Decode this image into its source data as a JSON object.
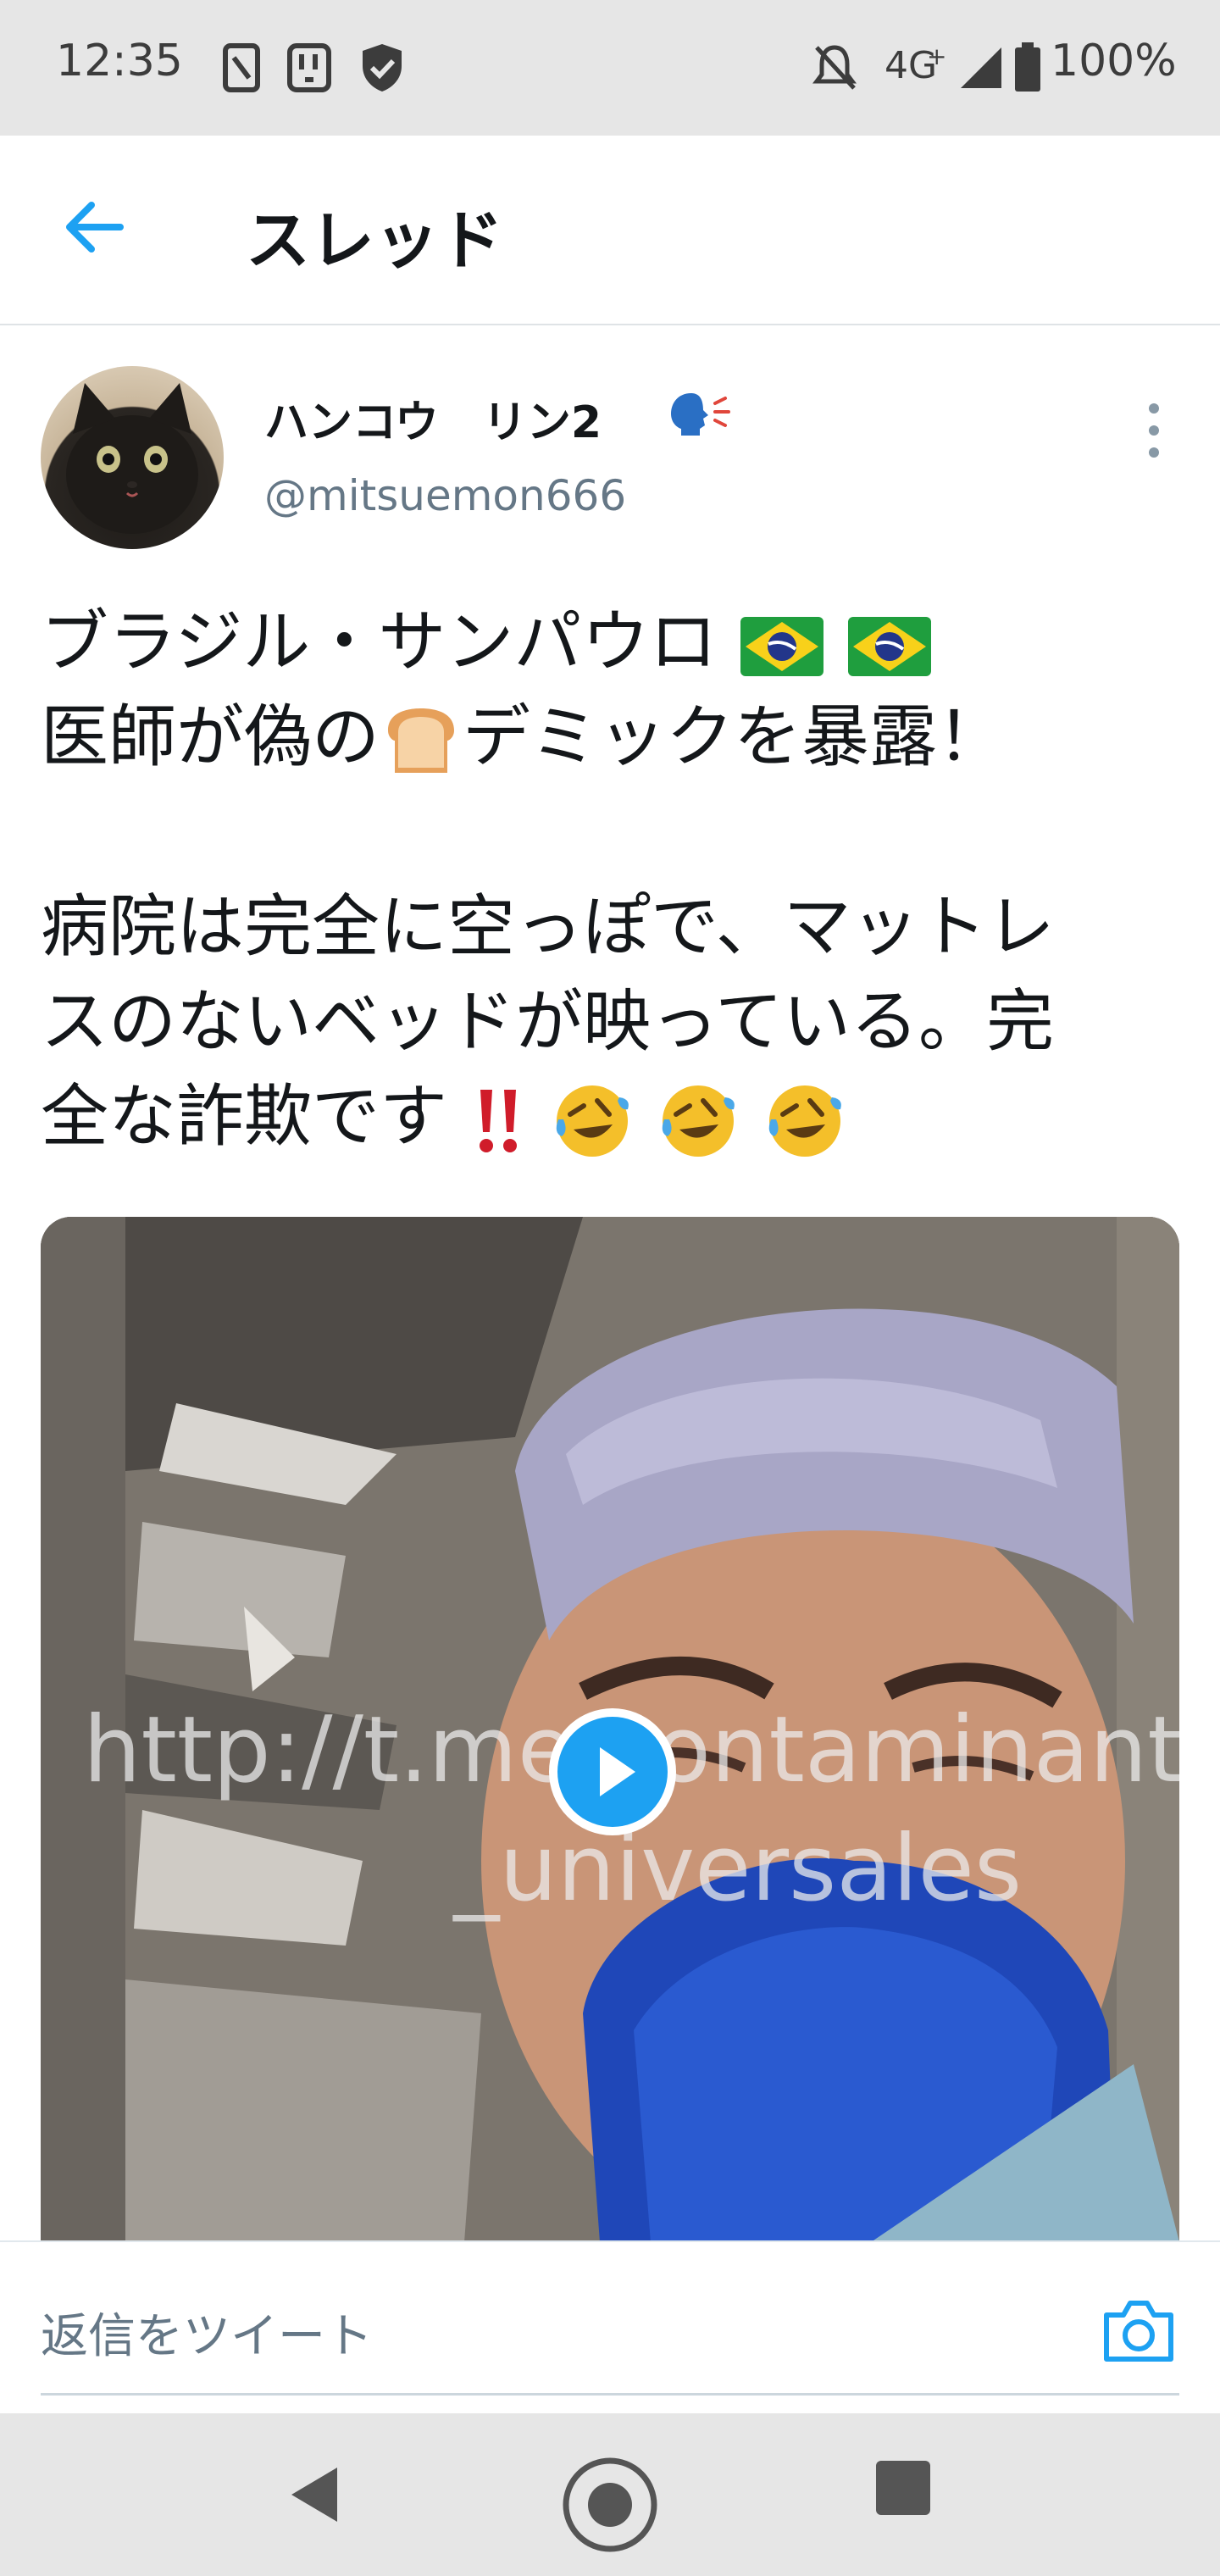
{
  "status_bar": {
    "time": "12:35",
    "network": "4G",
    "battery": "100%",
    "icons": [
      "sim-card-icon",
      "notification-app-icon",
      "shield-check-icon",
      "notifications-off-icon",
      "signal-icon",
      "battery-icon"
    ]
  },
  "header": {
    "title": "スレッド",
    "back_icon": "arrow-left-icon"
  },
  "tweet": {
    "display_name": "ハンコウ　リン2",
    "handle": "@mitsuemon666",
    "text_lines": [
      "ブラジル・サンパウロ",
      "医師が偽の",
      "デミックを暴露！",
      "病院は完全に空っぽで、マットレ",
      "スのないベッドが映っている。完",
      "全な詐欺です"
    ],
    "emojis": [
      "brazil-flag",
      "brazil-flag",
      "bread",
      "double-exclamation",
      "rolling-laughing",
      "rolling-laughing",
      "rolling-laughing"
    ],
    "media": {
      "type": "video",
      "watermark_line1": "http://t.me/contaminantes",
      "watermark_line2": "_universales"
    }
  },
  "reply": {
    "placeholder": "返信をツイート"
  },
  "nav": {
    "buttons": [
      "back-triangle-icon",
      "home-circle-icon",
      "recent-square-icon"
    ]
  },
  "colors": {
    "accent": "#1da1f2",
    "muted": "#657786",
    "text": "#14171a",
    "system_bar": "#e6e6e6"
  }
}
